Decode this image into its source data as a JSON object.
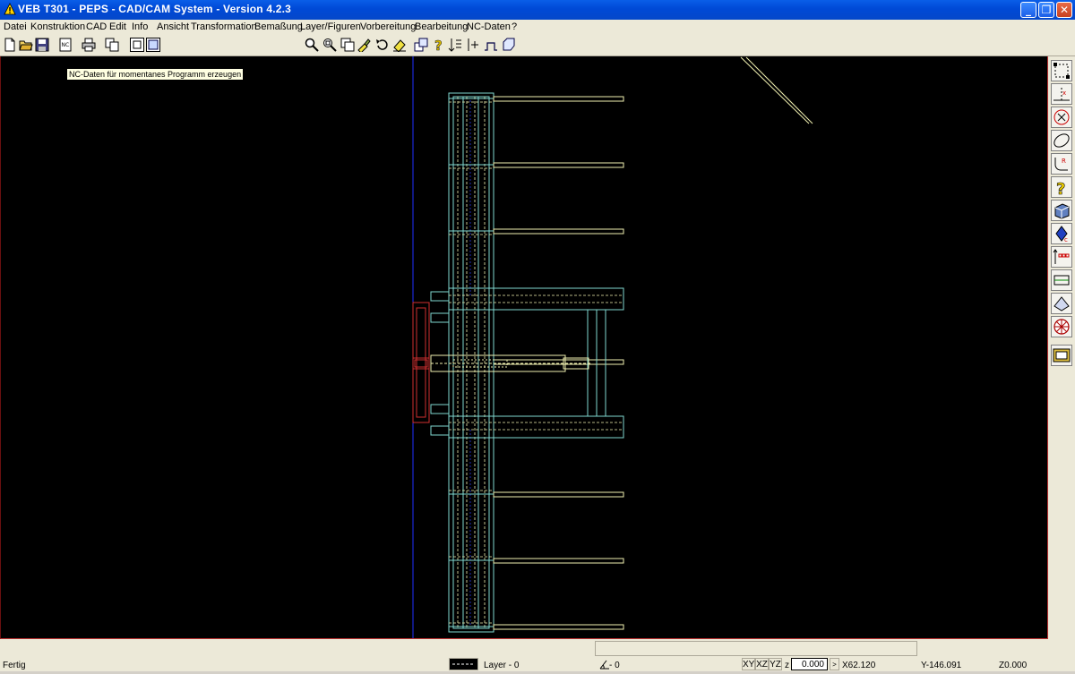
{
  "window": {
    "title": "VEB T301 - PEPS - CAD/CAM System - Version 4.2.3",
    "minimize_label": "_",
    "maximize_label": "❐",
    "close_label": "✕"
  },
  "menu": {
    "items": [
      "Datei",
      "Konstruktion",
      "CAD",
      "Edit",
      "Info",
      "Ansicht",
      "Transformation",
      "Bemaßung",
      "Layer/Figuren",
      "Vorbereitung",
      "Bearbeitung",
      "NC-Daten",
      "?"
    ]
  },
  "toolbar": {
    "icons": [
      "new-file-icon",
      "open-folder-icon",
      "save-icon",
      "nc-data-icon",
      "print-icon",
      "copy-icon",
      "frame-icon",
      "window-icon",
      "zoom-icon",
      "zoom-window-icon",
      "zoom-fit-icon",
      "pick-icon",
      "undo-icon",
      "erase-icon",
      "drawing-icon",
      "help-icon",
      "sort-icon",
      "insert-icon",
      "profile-icon",
      "contour-icon"
    ]
  },
  "tooltip": "NC-Daten für momentanes Programm erzeugen",
  "sidebar": {
    "icons": [
      "select-rectangle-icon",
      "point-icon",
      "circle-icon",
      "ellipse-icon",
      "radius-icon",
      "help-icon",
      "solid-icon",
      "snap-icon",
      "dimension-icon",
      "layer-icon",
      "layer-3d-icon",
      "wheel-icon",
      "nc-program-icon"
    ]
  },
  "status": {
    "ready": "Fertig",
    "layer": "Layer - 0",
    "angle_value": "- 0",
    "planes": [
      "XY",
      "XZ",
      "YZ"
    ],
    "z_label": "z",
    "z_value": "0.000",
    "x_coord": "X62.120",
    "y_coord": "Y-146.091",
    "z_coord": "Z0.000"
  },
  "colors": {
    "title_bar": "#0049d6",
    "canvas_background": "#000000",
    "cyan_geometry": "#7fd8d0",
    "yellow_geometry": "#f0f0b0",
    "red_geometry": "#d03030",
    "blue_axis": "#2030ff"
  }
}
